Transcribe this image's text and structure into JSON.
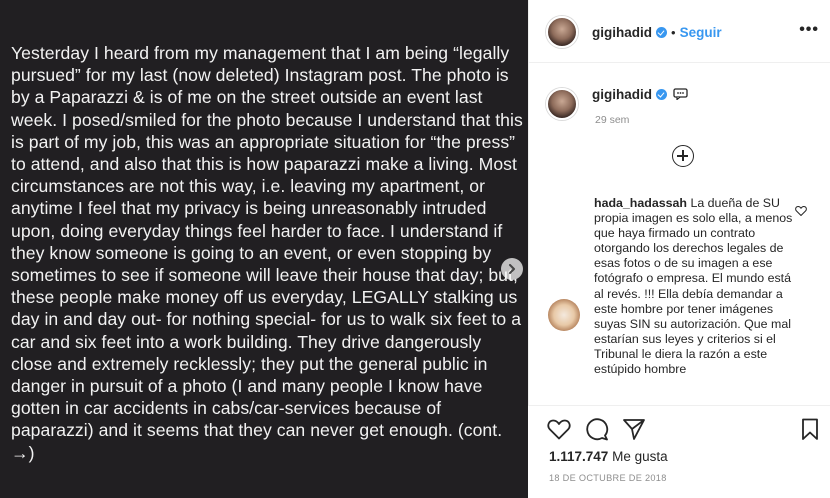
{
  "post": {
    "text": "Yesterday I heard from my management that I am being “legally pursued” for my last (now deleted) Instagram post. The photo is by a Paparazzi & is of me on the street outside an event last week. I posed/smiled for the photo because I understand that this is part of my job, this was an appropriate situation for “the press” to attend, and also that this is how paparazzi make a living. Most circumstances are not this way, i.e. leaving my apartment, or anytime I feel that my privacy is being unreasonably intruded upon, doing everyday things feel harder to face. I understand if they know someone is going to an event, or even stopping by sometimes to see if someone will leave their house that day; but, these people make money off us everyday, LEGALLY stalking us day in and day out- for nothing special- for us to walk six feet to a car and six feet into a work building. They drive dangerously close and extremely recklessly; they put the general public in danger in pursuit of a photo (I and many people I know have gotten in car accidents in cabs/car-services because of paparazzi) and it seems that they can never get enough. (cont. →)"
  },
  "header": {
    "username": "gigihadid",
    "separator": "•",
    "follow_label": "Seguir",
    "more_label": "•••"
  },
  "caption": {
    "username": "gigihadid",
    "time": "29 sem"
  },
  "comment": {
    "username": "hada_hadassah",
    "text": "La dueña de SU propia imagen es solo ella, a menos que haya firmado un contrato otorgando los derechos legales de esas fotos o de su imagen a ese fotógrafo o empresa. El mundo está al revés. !!! Ella debía demandar a este hombre por tener imágenes suyas SIN su autorización. Que mal estarían sus leyes y criterios si el Tribunal le diera la razón a este estúpido hombre"
  },
  "actions": {
    "likes_count": "1.117.747",
    "likes_label": "Me gusta",
    "date": "18 DE OCTUBRE DE 2018"
  },
  "colors": {
    "image_bg": "#211f22",
    "accent": "#3897f0",
    "muted": "#8e8e8e"
  },
  "icons": [
    "next-arrow-icon",
    "verified-icon",
    "more-options-icon",
    "chat-bubble-icon",
    "load-more-icon",
    "heart-icon",
    "comment-icon",
    "share-icon",
    "bookmark-icon"
  ]
}
